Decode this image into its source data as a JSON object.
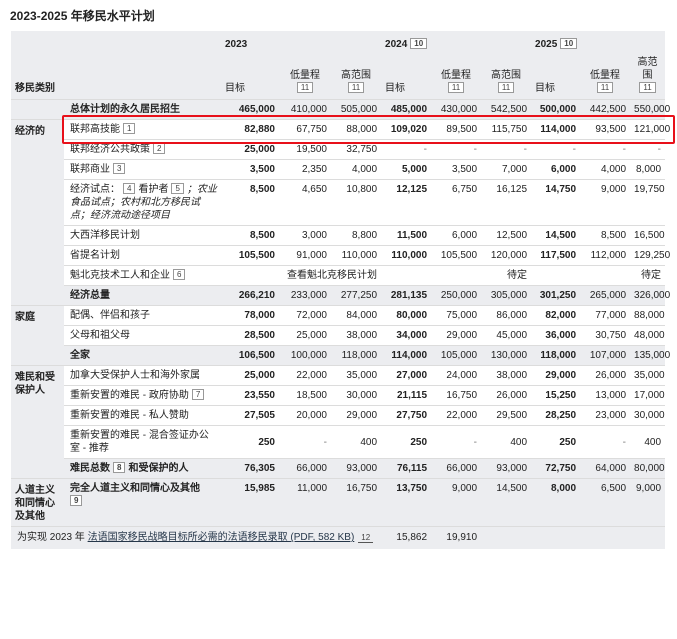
{
  "title": "2023-2025 年移民水平计划",
  "header": {
    "year_2023": "2023",
    "year_2024": "2024",
    "year_2025": "2025",
    "note_2024": "10",
    "note_2025": "10",
    "category_label": "移民类别",
    "target": "目标",
    "low": "低量程",
    "high": "高范围",
    "note_range": "11"
  },
  "categories": {
    "economic": "经济的",
    "family": "家庭",
    "refugee": "难民和受保护人",
    "humanitarian": "人道主义和同情心及其他"
  },
  "rows": {
    "total": {
      "label": "总体计划的永久居民招生",
      "v": [
        "465,000",
        "410,000",
        "505,000",
        "485,000",
        "430,000",
        "542,500",
        "500,000",
        "442,500",
        "550,000"
      ]
    },
    "fed_high": {
      "label": "联邦高技能",
      "note": "1",
      "v": [
        "82,880",
        "67,750",
        "88,000",
        "109,020",
        "89,500",
        "115,750",
        "114,000",
        "93,500",
        "121,000"
      ]
    },
    "fed_econ_public": {
      "label": "联邦经济公共政策",
      "note": "2",
      "v": [
        "25,000",
        "19,500",
        "32,750",
        "-",
        "-",
        "-",
        "-",
        "-",
        "-"
      ]
    },
    "fed_business": {
      "label": "联邦商业",
      "note": "3",
      "v": [
        "3,500",
        "2,350",
        "4,000",
        "5,000",
        "3,500",
        "7,000",
        "6,000",
        "4,000",
        "8,000"
      ]
    },
    "econ_pilots": {
      "label_a": "经济试点：",
      "note_a": "4",
      "label_b": "看护者",
      "note_b": "5",
      "label_c": "；农业食品试点；农村和北方移民试点；经济流动途径项目",
      "v": [
        "8,500",
        "4,650",
        "10,800",
        "12,125",
        "6,750",
        "16,125",
        "14,750",
        "9,000",
        "19,750"
      ]
    },
    "atlantic": {
      "label": "大西洋移民计划",
      "v": [
        "8,500",
        "3,000",
        "8,800",
        "11,500",
        "6,000",
        "12,500",
        "14,500",
        "8,500",
        "16,500"
      ]
    },
    "pnp": {
      "label": "省提名计划",
      "v": [
        "105,500",
        "91,000",
        "110,000",
        "110,000",
        "105,500",
        "120,000",
        "117,500",
        "112,000",
        "129,250"
      ]
    },
    "quebec_skilled": {
      "label": "魁北克技术工人和企业",
      "note": "6",
      "plan_2023": "查看魁北克移民计划",
      "tbd_2024": "待定",
      "tbd_2025": "待定"
    },
    "econ_total": {
      "label": "经济总量",
      "v": [
        "266,210",
        "233,000",
        "277,250",
        "281,135",
        "250,000",
        "305,000",
        "301,250",
        "265,000",
        "326,000"
      ]
    },
    "spouses": {
      "label": "配偶、伴侣和孩子",
      "v": [
        "78,000",
        "72,000",
        "84,000",
        "80,000",
        "75,000",
        "86,000",
        "82,000",
        "77,000",
        "88,000"
      ]
    },
    "parents": {
      "label": "父母和祖父母",
      "v": [
        "28,500",
        "25,000",
        "38,000",
        "34,000",
        "29,000",
        "45,000",
        "36,000",
        "30,750",
        "48,000"
      ]
    },
    "family_total": {
      "label": "全家",
      "v": [
        "106,500",
        "100,000",
        "118,000",
        "114,000",
        "105,000",
        "130,000",
        "118,000",
        "107,000",
        "135,000"
      ]
    },
    "protected": {
      "label": "加拿大受保护人士和海外家属",
      "v": [
        "25,000",
        "22,000",
        "35,000",
        "27,000",
        "24,000",
        "38,000",
        "29,000",
        "26,000",
        "35,000"
      ]
    },
    "gar": {
      "label": "重新安置的难民 - 政府协助",
      "note": "7",
      "v": [
        "23,550",
        "18,500",
        "30,000",
        "21,115",
        "16,750",
        "26,000",
        "15,250",
        "13,000",
        "17,000"
      ]
    },
    "psr": {
      "label": "重新安置的难民 - 私人赞助",
      "v": [
        "27,505",
        "20,000",
        "29,000",
        "27,750",
        "22,000",
        "29,500",
        "28,250",
        "23,000",
        "30,000"
      ]
    },
    "bvor": {
      "label": "重新安置的难民 - 混合签证办公室 - 推荐",
      "v": [
        "250",
        "-",
        "400",
        "250",
        "-",
        "400",
        "250",
        "-",
        "400"
      ]
    },
    "refugee_total": {
      "label_a": "难民总数",
      "note": "8",
      "label_b": "和受保护的人",
      "v": [
        "76,305",
        "66,000",
        "93,000",
        "76,115",
        "66,000",
        "93,000",
        "72,750",
        "64,000",
        "80,000"
      ]
    },
    "humanitarian_total": {
      "label": "完全人道主义和同情心及其他",
      "note": "9",
      "v": [
        "15,985",
        "11,000",
        "16,750",
        "13,750",
        "9,000",
        "14,500",
        "8,000",
        "6,500",
        "9,000"
      ]
    }
  },
  "footer": {
    "prefix": "为实现 2023 年",
    "link": "法语国家移民战略目标所必需的法语移民录取 (PDF, 582 KB)",
    "note": "12",
    "v1": "15,862",
    "v2": "19,910"
  },
  "colors": {
    "header_bg": "#ecedf0",
    "highlight": "#e8101a"
  }
}
